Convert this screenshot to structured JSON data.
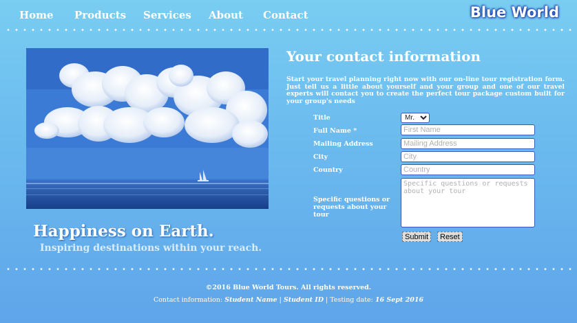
{
  "nav": {
    "items": [
      "Home",
      "Products",
      "Services",
      "About",
      "Contact"
    ],
    "brand": "Blue World"
  },
  "hero": {
    "title": "Happiness on Earth.",
    "subtitle": "Inspiring destinations within your reach."
  },
  "form": {
    "heading": "Your contact information",
    "intro": "Start your travel planning right now with our on-line tour registration form. Just tell us a little about yourself and your group and one of our travel experts will contact you to create the perfect tour package custom built for your group's needs",
    "labels": {
      "title": "Title",
      "full_name": "Full Name *",
      "mailing_address": "Mailing Address",
      "city": "City",
      "country": "Country",
      "questions": "Specific questions or requests about your tour"
    },
    "title_value": "Mr.",
    "placeholders": {
      "first_name": "First Name",
      "mailing_address": "Mailing Address",
      "city": "City",
      "country": "Country",
      "questions": "Specific questions or requests about your tour"
    },
    "submit_label": "Submit",
    "reset_label": "Reset"
  },
  "footer": {
    "copyright": "©2016 Blue World Tours. All rights reserved.",
    "contact_prefix": "Contact information: ",
    "student_name": "Student Name",
    "separator1": " | ",
    "student_id": "Student ID",
    "separator2": " | Testing date: ",
    "testing_date": "16 Sept 2016"
  },
  "colors": {
    "background_top": "#79cdf1",
    "background_bottom": "#5fa5ea",
    "field_border": "#3857b8"
  }
}
